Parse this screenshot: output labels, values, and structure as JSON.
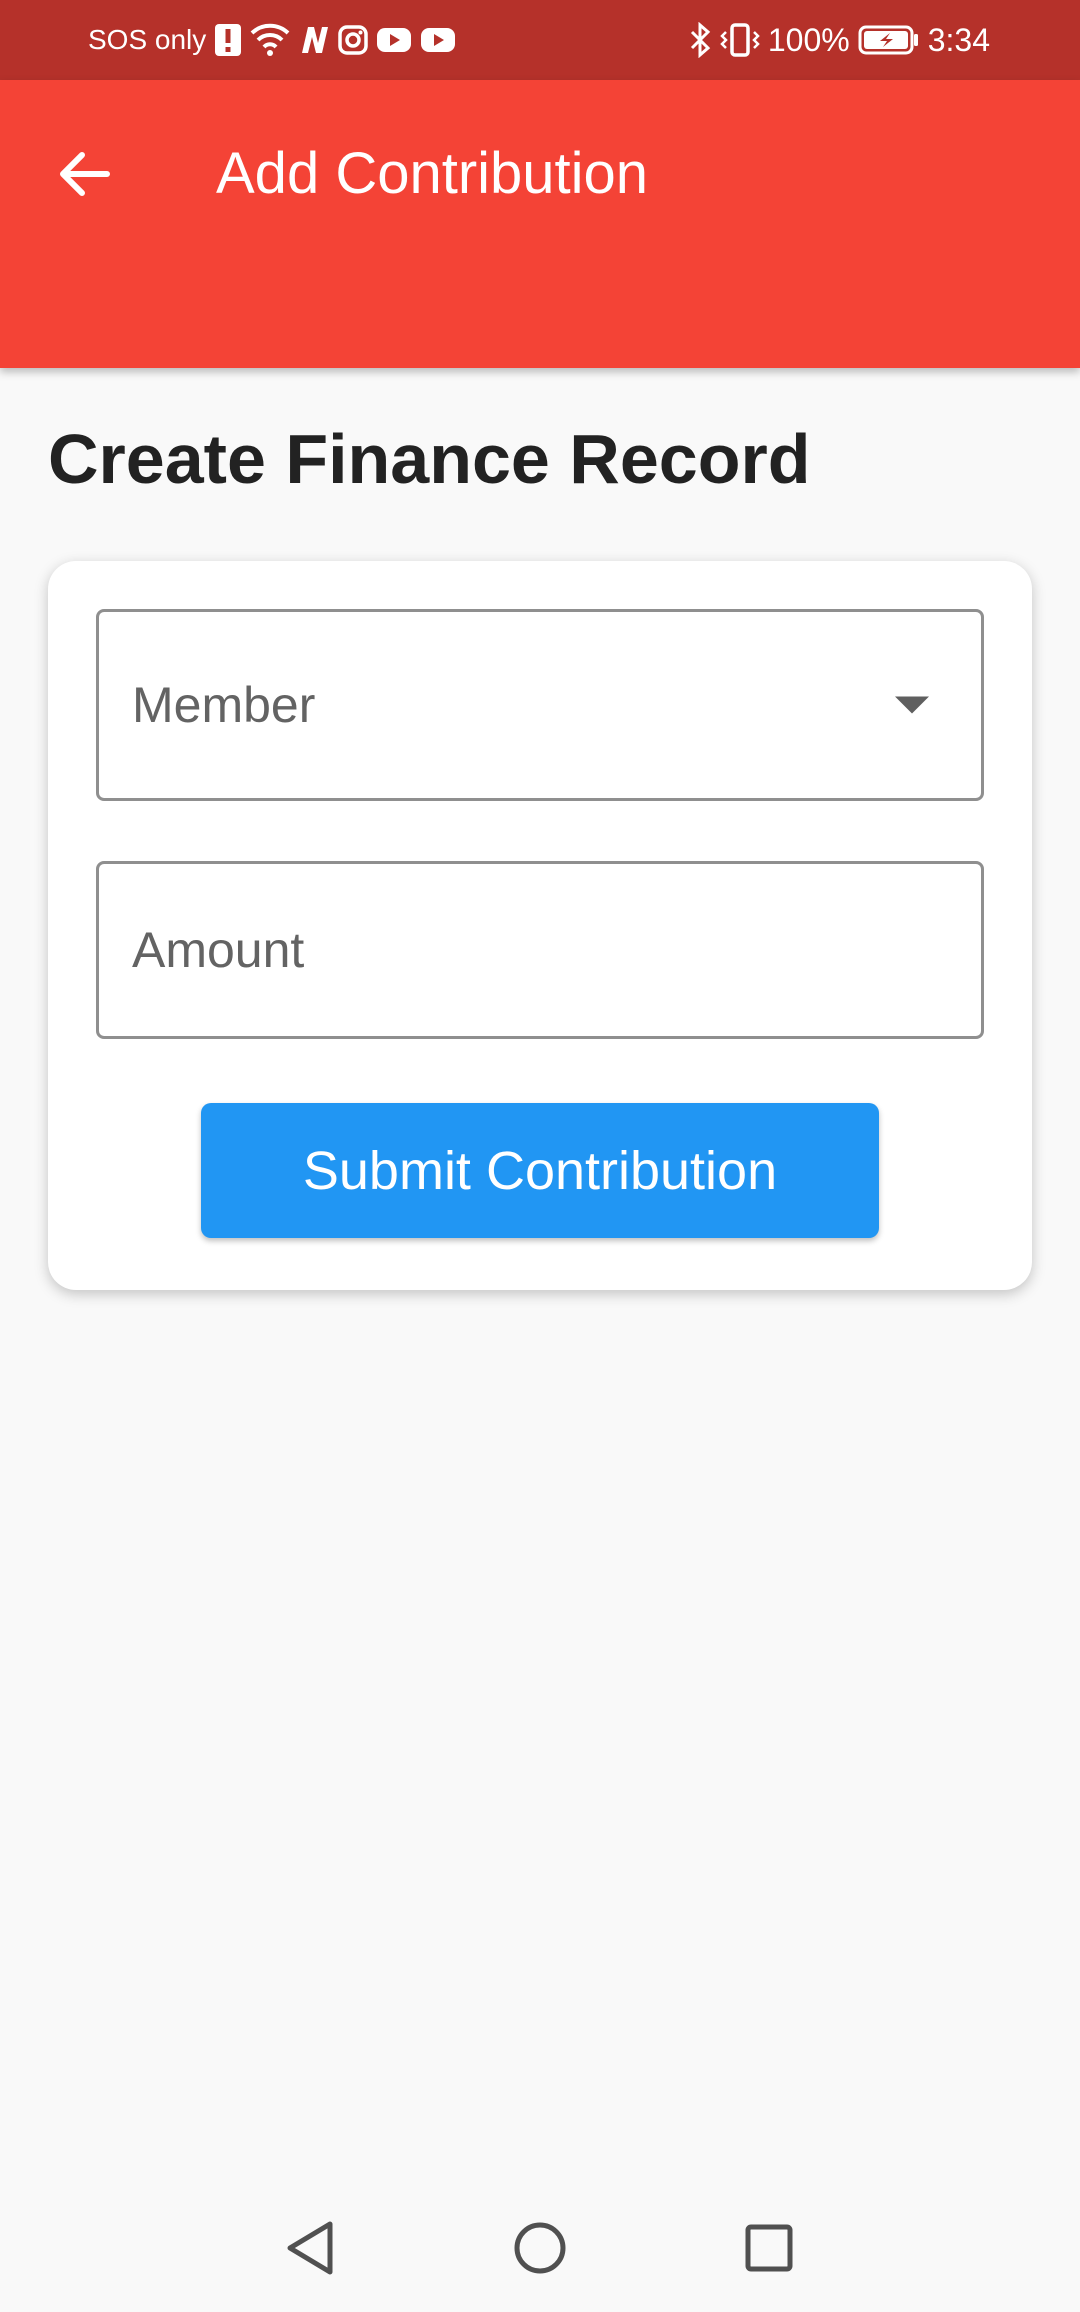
{
  "status_bar": {
    "carrier": "SOS only",
    "battery_percent": "100%",
    "time": "3:34",
    "left_icons": [
      "alert-icon",
      "wifi-icon",
      "n-app-icon",
      "instagram-icon",
      "youtube-icon",
      "youtube-icon"
    ],
    "right_icons": [
      "bluetooth-icon",
      "vibrate-icon",
      "battery-charging-icon"
    ]
  },
  "app_bar": {
    "title": "Add Contribution",
    "back_icon": "arrow-back-icon",
    "color": "#f44336"
  },
  "page": {
    "title": "Create Finance Record"
  },
  "form": {
    "member": {
      "placeholder": "Member",
      "value": ""
    },
    "amount": {
      "placeholder": "Amount",
      "value": ""
    },
    "submit_label": "Submit Contribution",
    "submit_color": "#2196f3"
  },
  "nav_bar": {
    "buttons": [
      "back-triangle-icon",
      "home-circle-icon",
      "recents-square-icon"
    ]
  }
}
